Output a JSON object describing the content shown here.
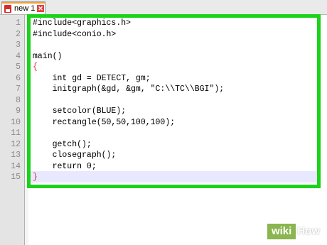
{
  "tab": {
    "label": "new 1",
    "file_icon": "notepad-file-icon",
    "close_icon": "close-icon"
  },
  "editor": {
    "line_numbers": [
      "1",
      "2",
      "3",
      "4",
      "5",
      "6",
      "7",
      "8",
      "9",
      "10",
      "11",
      "12",
      "13",
      "14",
      "15"
    ],
    "lines": [
      "#include<graphics.h>",
      "#include<conio.h>",
      "",
      "main()",
      "{",
      "    int gd = DETECT, gm;",
      "    initgraph(&gd, &gm, \"C:\\\\TC\\\\BGI\");",
      "",
      "    setcolor(BLUE);",
      "    rectangle(50,50,100,100);",
      "",
      "    getch();",
      "    closegraph();",
      "    return 0;",
      "}"
    ],
    "brace_color": "#e03030",
    "highlight_color": "#1ad21a"
  },
  "watermark": {
    "wiki": "wiki",
    "how": "How"
  }
}
